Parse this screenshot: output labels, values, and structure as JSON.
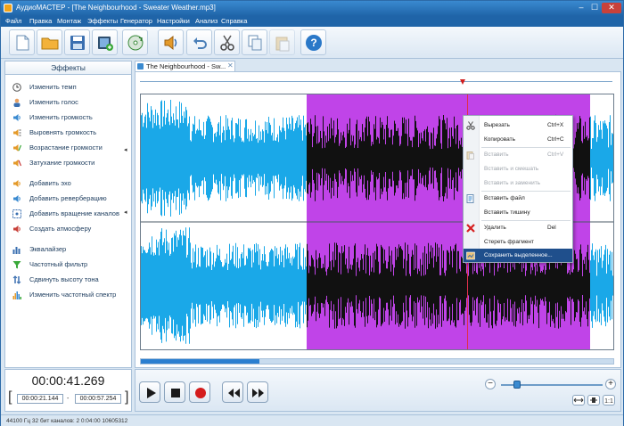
{
  "window": {
    "title": "АудиоМАСТЕР - [The Neighbourhood - Sweater Weather.mp3]",
    "min": "–",
    "max": "☐",
    "close": "✕"
  },
  "menu": [
    "Файл",
    "Правка",
    "Монтаж",
    "Эффекты",
    "Генератор",
    "Настройки",
    "Анализ",
    "Справка"
  ],
  "toolbar": {
    "icons": [
      "new-file-icon",
      "open-folder-icon",
      "save-disk-icon",
      "add-clip-icon",
      "refresh-cd-icon",
      "sound-speaker-icon",
      "undo-icon",
      "cut-scissors-icon",
      "copy-icon",
      "paste-icon",
      "help-icon"
    ]
  },
  "effects_panel": {
    "title": "Эффекты",
    "items": [
      {
        "label": "Изменить темп",
        "icon": "tempo-clock-icon"
      },
      {
        "label": "Изменить голос",
        "icon": "voice-person-icon"
      },
      {
        "label": "Изменить громкость",
        "icon": "volume-speaker-icon"
      },
      {
        "label": "Выровнять громкость",
        "icon": "normalize-icon"
      },
      {
        "label": "Возрастание громкости",
        "icon": "fade-in-icon"
      },
      {
        "label": "Затухание громкости",
        "icon": "fade-out-icon"
      },
      {
        "label": "Добавить эхо",
        "icon": "echo-icon"
      },
      {
        "label": "Добавить реверберацию",
        "icon": "reverb-icon"
      },
      {
        "label": "Добавить вращение каналов",
        "icon": "rotate-channels-icon"
      },
      {
        "label": "Создать атмосферу",
        "icon": "atmosphere-icon"
      },
      {
        "label": "Эквалайзер",
        "icon": "equalizer-icon"
      },
      {
        "label": "Частотный фильтр",
        "icon": "filter-funnel-icon"
      },
      {
        "label": "Сдвинуть высоту тона",
        "icon": "pitch-shift-icon"
      },
      {
        "label": "Изменить частотный спектр",
        "icon": "spectrum-icon"
      }
    ]
  },
  "tab": {
    "label": "The Neighbourhood - Sw...",
    "close": "✕"
  },
  "selection": {
    "start_fraction": 0.35,
    "end_fraction": 0.95,
    "cursor_fraction": 0.69,
    "colors": {
      "unselected": "#1aa8e8",
      "selected": "#c044e8",
      "wave_selected": "#111111",
      "cursor": "#e0304a"
    }
  },
  "scroll": {
    "visible_fraction": 0.25
  },
  "context_menu": {
    "items": [
      {
        "label": "Вырезать",
        "shortcut": "Ctrl+X",
        "enabled": true,
        "icon": "scissors-icon"
      },
      {
        "label": "Копировать",
        "shortcut": "Ctrl+C",
        "enabled": true,
        "icon": ""
      },
      {
        "label": "Вставить",
        "shortcut": "Ctrl+V",
        "enabled": false,
        "icon": "paste-icon"
      },
      {
        "label": "Вставить и смешать",
        "shortcut": "",
        "enabled": false,
        "icon": ""
      },
      {
        "label": "Вставить и заменить",
        "shortcut": "",
        "enabled": false,
        "icon": ""
      },
      {
        "label": "Вставить файл",
        "shortcut": "",
        "enabled": true,
        "icon": "insert-file-icon"
      },
      {
        "label": "Вставить тишину",
        "shortcut": "",
        "enabled": true,
        "icon": ""
      },
      {
        "label": "Удалить",
        "shortcut": "Del",
        "enabled": true,
        "icon": "delete-x-icon"
      },
      {
        "label": "Стереть фрагмент",
        "shortcut": "",
        "enabled": true,
        "icon": ""
      },
      {
        "label": "Сохранить выделенное...",
        "shortcut": "",
        "enabled": true,
        "icon": "save-selection-icon",
        "highlighted": true
      }
    ]
  },
  "time": {
    "current": "00:00:41.269",
    "sel_start": "00:00:21.144",
    "sel_end": "00:00:57.254",
    "separator": "-"
  },
  "zoom": {
    "level_fraction": 0.12,
    "minus": "−",
    "plus": "+"
  },
  "status": {
    "text": "44100 Гц  32 бит  каналов: 2   0:04:00 10605312"
  }
}
